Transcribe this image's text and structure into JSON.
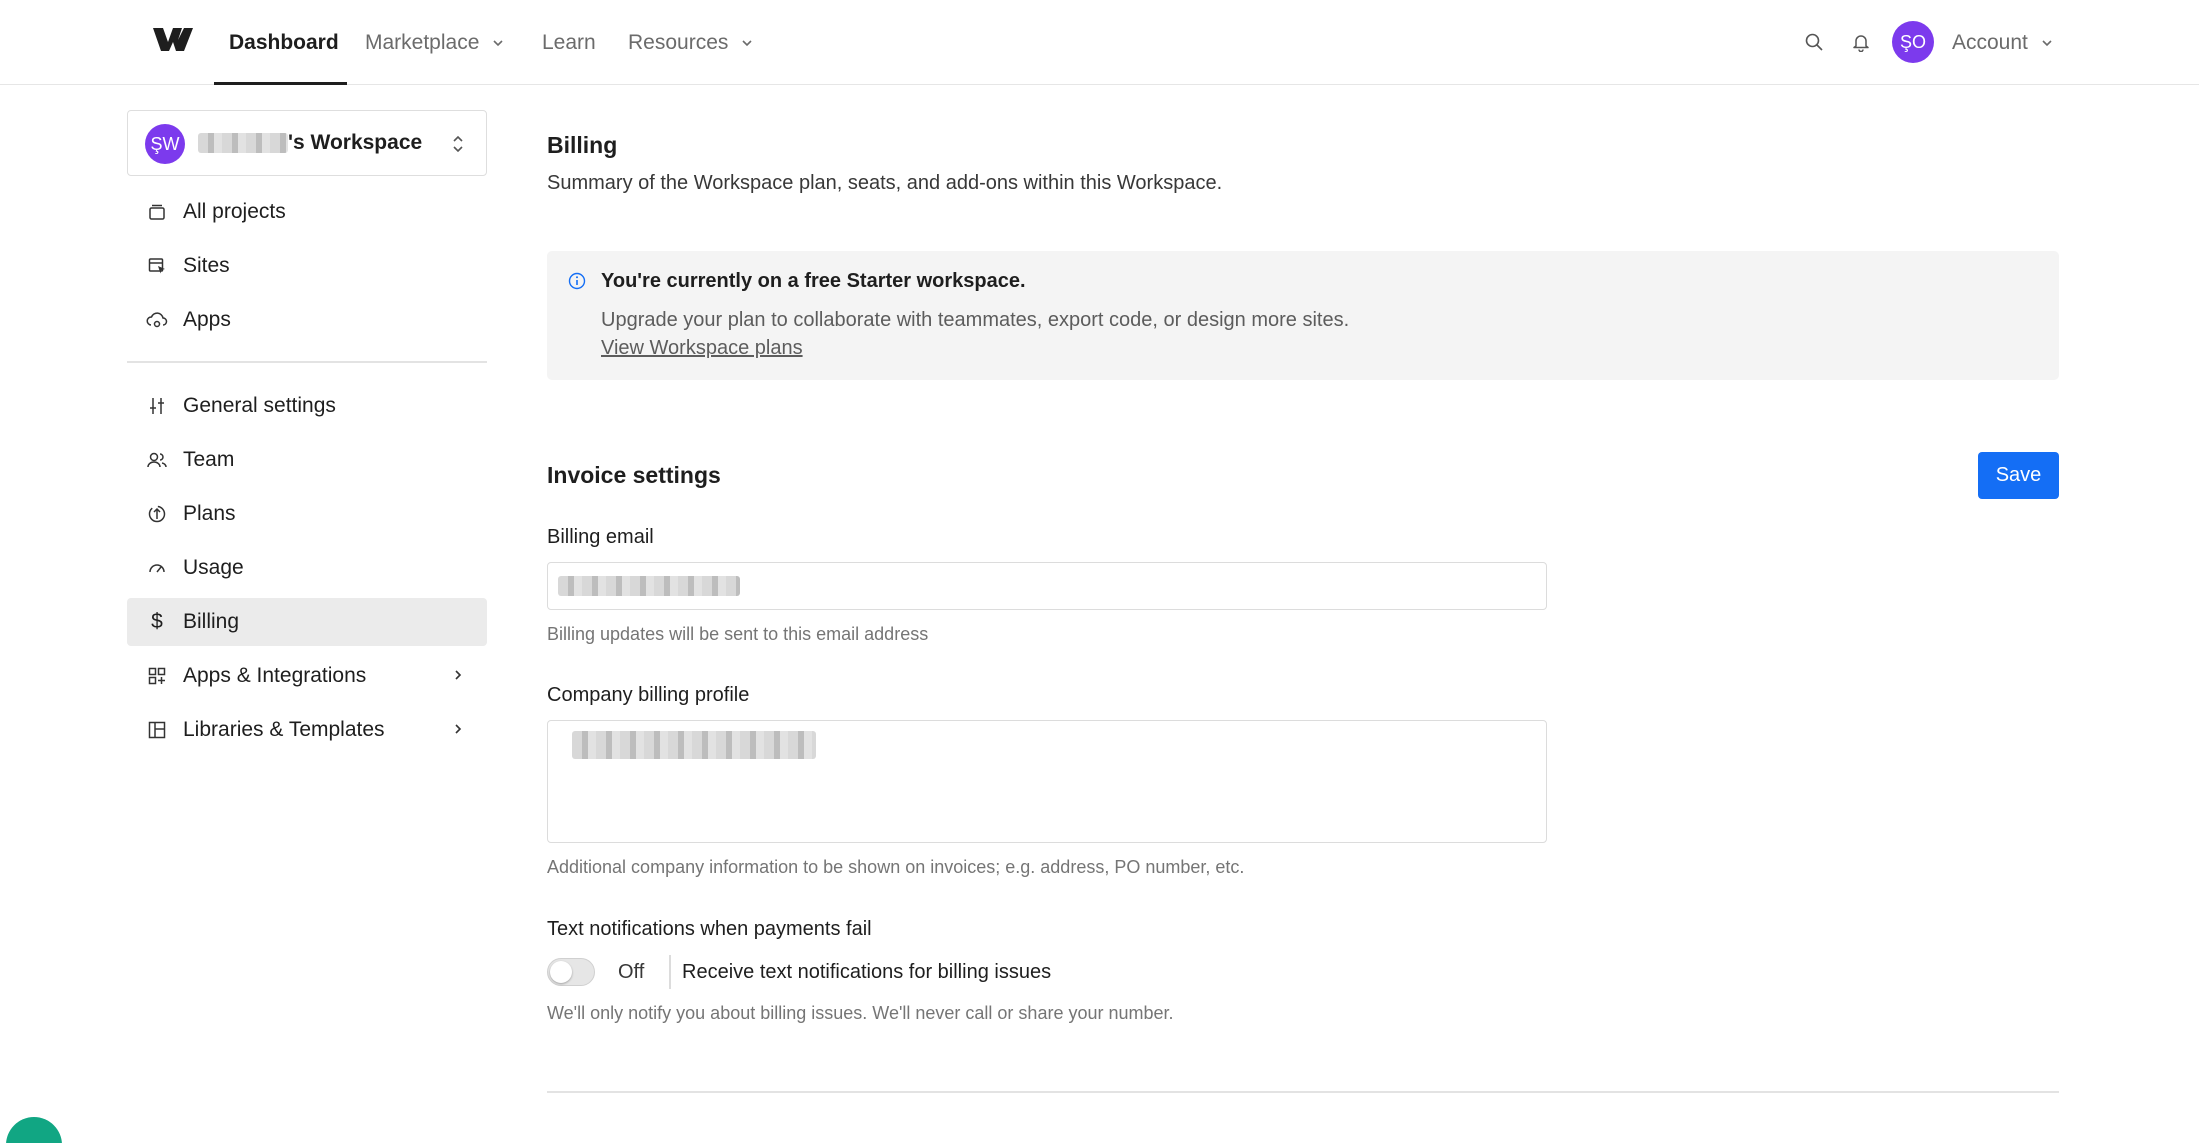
{
  "topnav": {
    "logo": "webflow-logo",
    "items": [
      {
        "label": "Dashboard",
        "active": true
      },
      {
        "label": "Marketplace",
        "has_menu": true
      },
      {
        "label": "Learn"
      },
      {
        "label": "Resources",
        "has_menu": true
      }
    ],
    "avatar_initials": "ŞO",
    "account_label": "Account"
  },
  "sidebar": {
    "workspace": {
      "initials": "ŞW",
      "name_suffix": "'s Workspace"
    },
    "group1": [
      {
        "label": "All projects",
        "icon": "folder-icon"
      },
      {
        "label": "Sites",
        "icon": "sites-icon"
      },
      {
        "label": "Apps",
        "icon": "cloud-apps-icon"
      }
    ],
    "group2": [
      {
        "label": "General settings",
        "icon": "sliders-icon"
      },
      {
        "label": "Team",
        "icon": "team-icon"
      },
      {
        "label": "Plans",
        "icon": "plans-icon"
      },
      {
        "label": "Usage",
        "icon": "gauge-icon"
      },
      {
        "label": "Billing",
        "icon": "dollar-icon",
        "selected": true
      },
      {
        "label": "Apps & Integrations",
        "icon": "grid-plus-icon",
        "has_submenu": true
      },
      {
        "label": "Libraries & Templates",
        "icon": "layout-icon",
        "has_submenu": true
      }
    ]
  },
  "main": {
    "title": "Billing",
    "subtitle": "Summary of the Workspace plan, seats, and add-ons within this Workspace.",
    "notice": {
      "title": "You're currently on a free Starter workspace.",
      "text": "Upgrade your plan to collaborate with teammates, export code, or design more sites.",
      "link": "View Workspace plans"
    },
    "invoice": {
      "title": "Invoice settings",
      "save_label": "Save",
      "billing_email_label": "Billing email",
      "billing_email_hint": "Billing updates will be sent to this email address",
      "company_profile_label": "Company billing profile",
      "company_profile_hint": "Additional company information to be shown on invoices; e.g. address, PO number, etc.",
      "text_notifications_label": "Text notifications when payments fail",
      "toggle_state": "Off",
      "toggle_description": "Receive text notifications for billing issues",
      "notifications_hint": "We'll only notify you about billing issues. We'll never call or share your number."
    }
  },
  "colors": {
    "accent": "#146ef5",
    "avatar": "#7c3aed",
    "sidebar_selected": "#ebebeb",
    "notice_bg": "#f4f4f4"
  }
}
